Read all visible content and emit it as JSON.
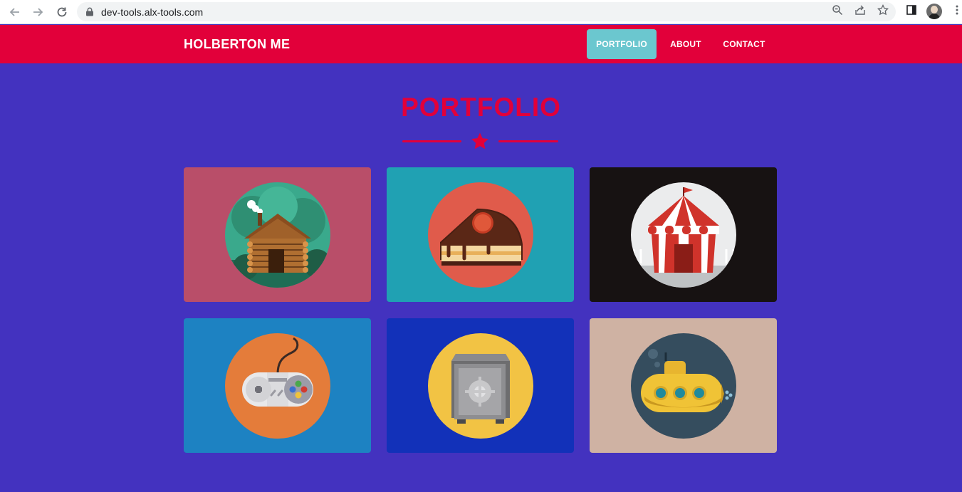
{
  "browser": {
    "url": "dev-tools.alx-tools.com"
  },
  "header": {
    "brand": "HOLBERTON ME",
    "nav": [
      {
        "label": "PORTFOLIO",
        "active": true
      },
      {
        "label": "ABOUT",
        "active": false
      },
      {
        "label": "CONTACT",
        "active": false
      }
    ]
  },
  "main": {
    "title": "PORTFOLIO",
    "divider_icon": "star-icon",
    "cards": [
      {
        "image": "cabin-icon",
        "background": "#b94e69",
        "circle": "#3aa98c"
      },
      {
        "image": "cake-icon",
        "background": "#20a1b3",
        "circle": "#e05b4b"
      },
      {
        "image": "circus-tent-icon",
        "background": "#171212",
        "circle": "#ebeced"
      },
      {
        "image": "game-controller-icon",
        "background": "#1d82c2",
        "circle": "#e47c3a"
      },
      {
        "image": "safe-icon",
        "background": "#1231b9",
        "circle": "#f2c344"
      },
      {
        "image": "submarine-icon",
        "background": "#cfb2a3",
        "circle": "#354d5e"
      }
    ]
  },
  "colors": {
    "accent": "#e2003a",
    "page_background": "#4332bf",
    "active_nav": "#6bc7cf"
  }
}
